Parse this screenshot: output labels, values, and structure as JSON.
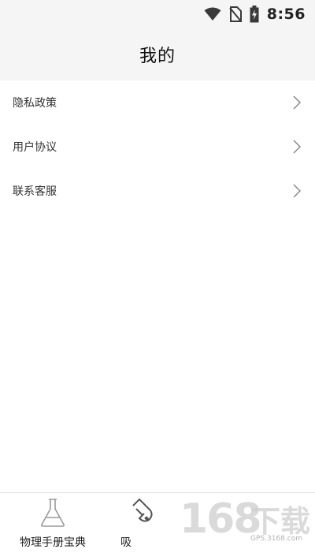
{
  "status_bar": {
    "time": "8:56",
    "icons": [
      "wifi-icon",
      "no-sim-icon",
      "battery-charging-icon"
    ]
  },
  "header": {
    "title": "我的"
  },
  "menu": {
    "items": [
      {
        "label": "隐私政策",
        "icon": "chevron-right-icon"
      },
      {
        "label": "用户协议",
        "icon": "chevron-right-icon"
      },
      {
        "label": "联系客服",
        "icon": "chevron-right-icon"
      }
    ]
  },
  "tab_bar": {
    "tabs": [
      {
        "label": "物理手册宝典",
        "icon": "flask-icon"
      },
      {
        "label": "吸",
        "icon": "magnet-icon"
      }
    ]
  },
  "watermark": {
    "numbers": "168",
    "chars": "下载",
    "sub": "GPS.3168.com"
  },
  "colors": {
    "header_bg": "#f5f5f5",
    "background": "#ffffff",
    "text": "#333333",
    "chevron": "#888888"
  }
}
